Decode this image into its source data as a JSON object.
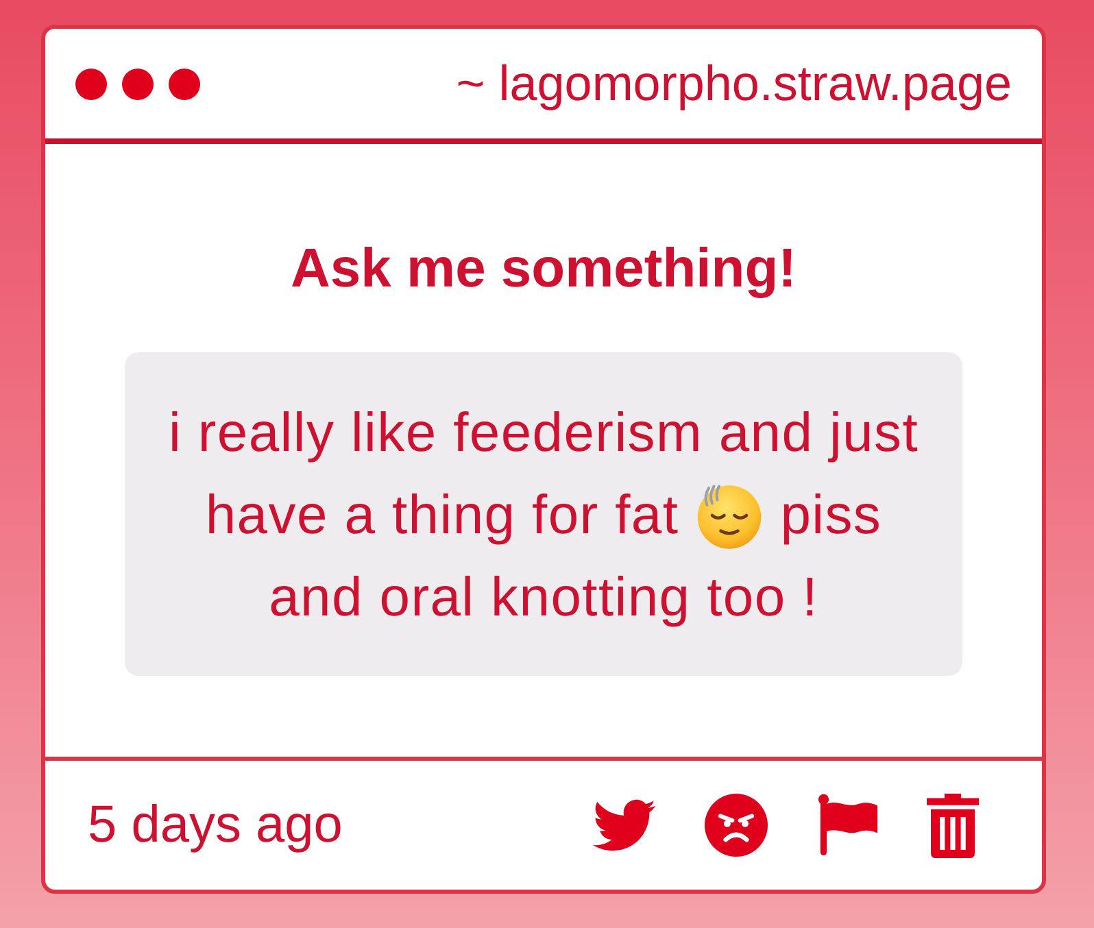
{
  "window": {
    "url": "~ lagomorpho.straw.page"
  },
  "prompt": {
    "title": "Ask me something!"
  },
  "question": {
    "lines": [
      {
        "parts": [
          {
            "kind": "text",
            "text": "i really like feederism and just"
          }
        ]
      },
      {
        "parts": [
          {
            "kind": "text",
            "text": "have a thing for fat"
          },
          {
            "kind": "emoji"
          },
          {
            "kind": "text",
            "text": "piss"
          }
        ]
      },
      {
        "parts": [
          {
            "kind": "text",
            "text": "and oral knotting too !"
          }
        ]
      }
    ]
  },
  "footer": {
    "time": "5 days ago"
  }
}
